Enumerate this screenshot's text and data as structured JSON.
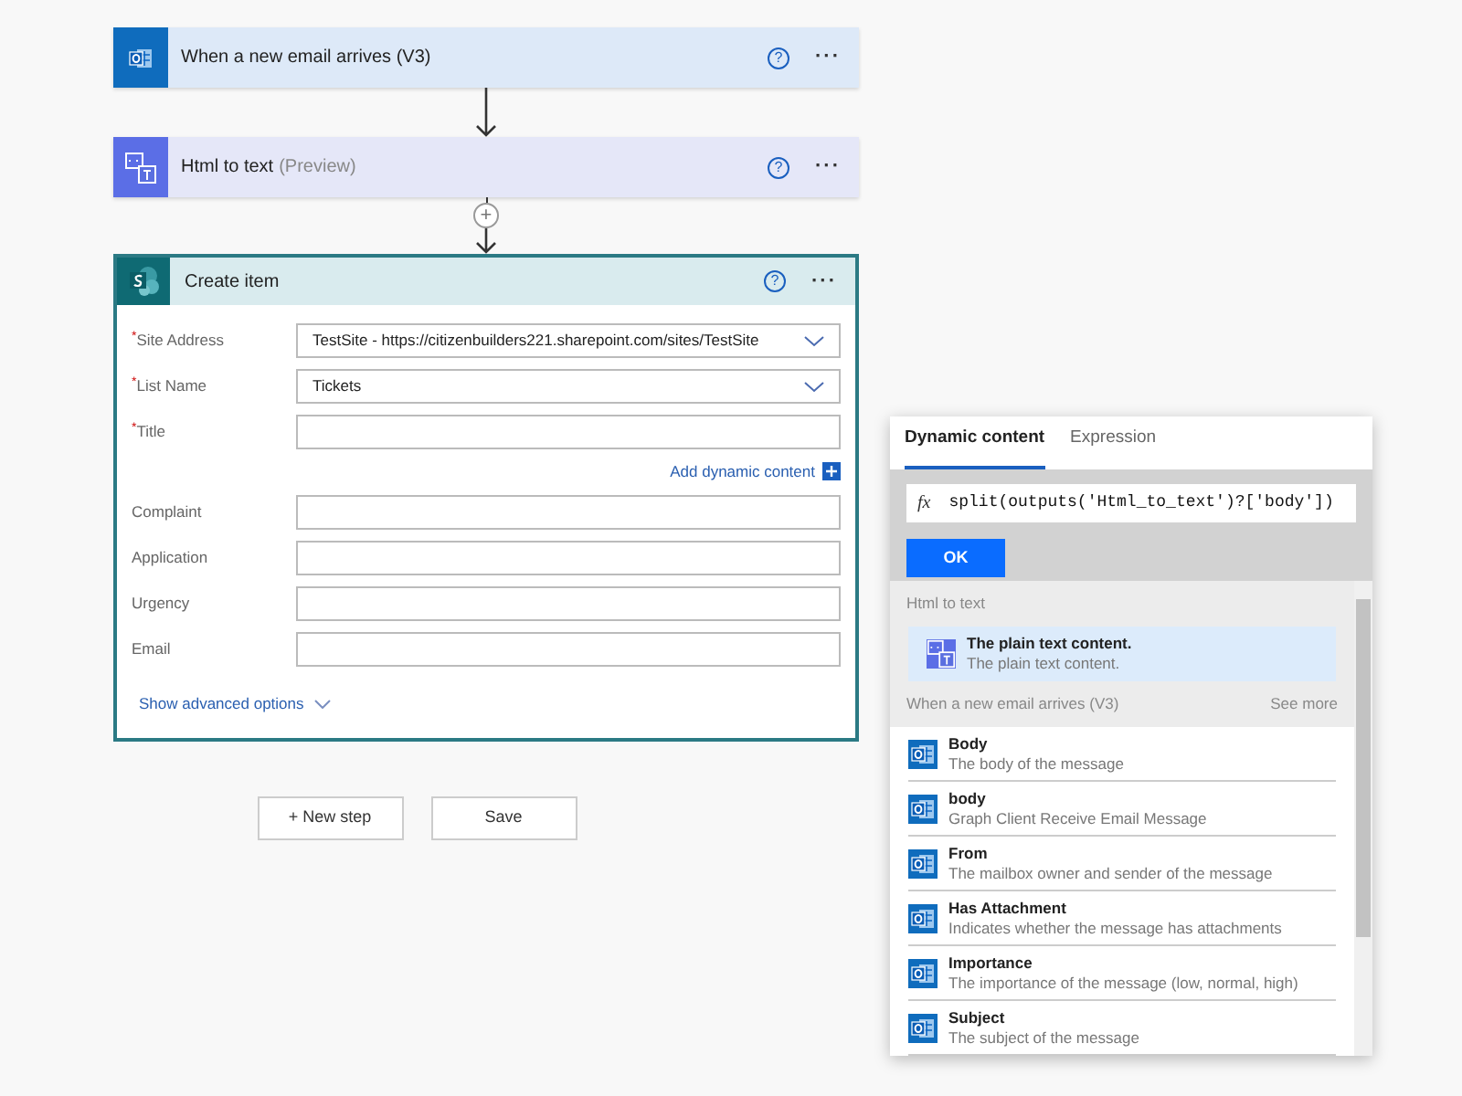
{
  "flow_steps": [
    {
      "kind": "outlook",
      "title": "When a new email arrives (V3)",
      "help": "?",
      "more": "···"
    },
    {
      "kind": "html",
      "title": "Html to text",
      "tag": "(Preview)",
      "help": "?",
      "more": "···",
      "add_step": "+"
    }
  ],
  "create_item": {
    "title": "Create item",
    "help": "?",
    "more": "···",
    "fields": [
      {
        "kind": "dropdown",
        "label": "Site Address",
        "required_mark": "*",
        "value": "TestSite - https://citizenbuilders221.sharepoint.com/sites/TestSite"
      },
      {
        "kind": "dropdown",
        "label": "List Name",
        "required_mark": "*",
        "value": "Tickets"
      },
      {
        "kind": "text",
        "label": "Title",
        "required_mark": "*",
        "link": "Add dynamic content"
      },
      {
        "kind": "text",
        "label": "Complaint"
      },
      {
        "kind": "text",
        "label": "Application"
      },
      {
        "kind": "text",
        "label": "Urgency"
      },
      {
        "kind": "text",
        "label": "Email"
      }
    ],
    "advanced": "Show advanced options"
  },
  "buttons": [
    "+ New step",
    "Save"
  ],
  "panel": {
    "tabs": [
      {
        "label": "Dynamic content",
        "selected": true
      },
      {
        "label": "Expression",
        "selected": false
      }
    ],
    "fx": "fx",
    "expression": "split(outputs('Html_to_text')?['body'])",
    "ok": "OK",
    "sections": [
      {
        "title": "Html to text",
        "kind": "html",
        "items": [
          {
            "name": "The plain text content.",
            "description": "The plain text content.",
            "selected": true
          }
        ]
      },
      {
        "title": "When a new email arrives (V3)",
        "kind": "outlook",
        "see_more": "See more",
        "items": [
          {
            "name": "Body",
            "description": "The body of the message",
            "selected": false
          },
          {
            "name": "body",
            "description": "Graph Client Receive Email Message",
            "selected": false
          },
          {
            "name": "From",
            "description": "The mailbox owner and sender of the message",
            "selected": false
          },
          {
            "name": "Has Attachment",
            "description": "Indicates whether the message has attachments",
            "selected": false
          },
          {
            "name": "Importance",
            "description": "The importance of the message (low, normal, high)",
            "selected": false
          },
          {
            "name": "Subject",
            "description": "The subject of the message",
            "selected": false
          }
        ]
      }
    ]
  }
}
